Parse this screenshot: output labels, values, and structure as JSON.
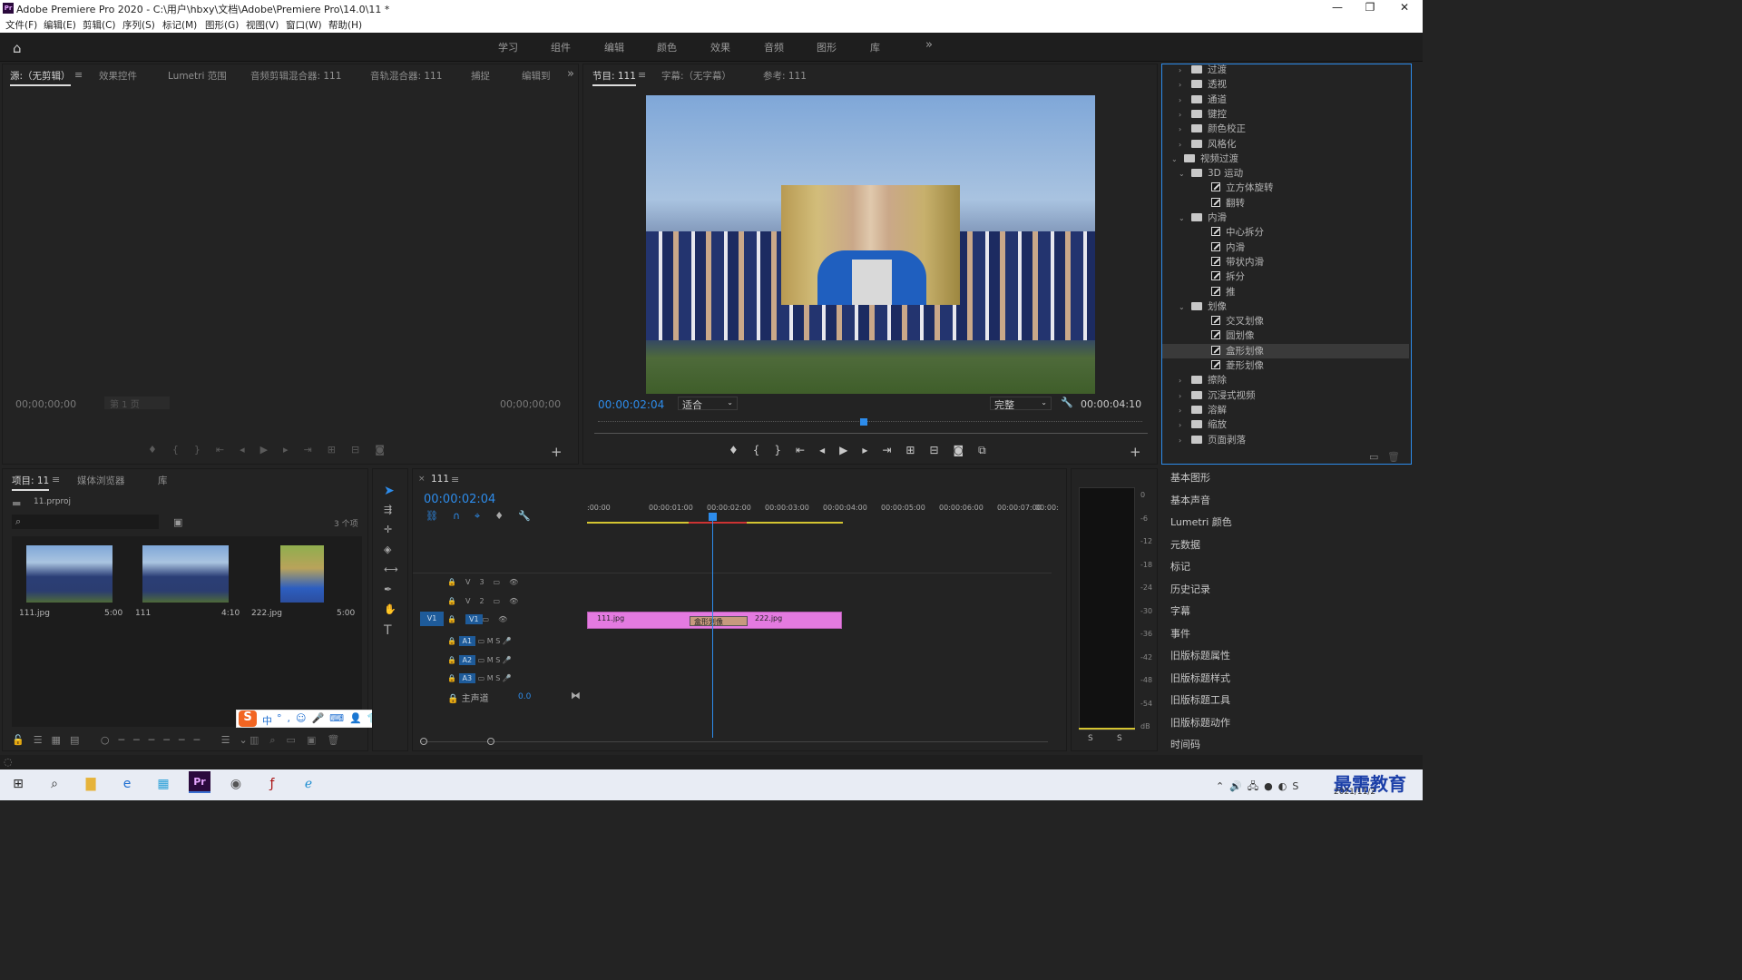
{
  "titlebar": {
    "title": "Adobe Premiere Pro 2020 - C:\\用户\\hbxy\\文档\\Adobe\\Premiere Pro\\14.0\\11 *",
    "minimize": "—",
    "maximize": "❐",
    "close": "✕"
  },
  "menu": [
    "文件(F)",
    "编辑(E)",
    "剪辑(C)",
    "序列(S)",
    "标记(M)",
    "图形(G)",
    "视图(V)",
    "窗口(W)",
    "帮助(H)"
  ],
  "workspaces": [
    "学习",
    "组件",
    "编辑",
    "颜色",
    "效果",
    "音频",
    "图形",
    "库"
  ],
  "source_panel": {
    "tabs": [
      "源:（无剪辑）",
      "效果控件",
      "Lumetri 范围",
      "音频剪辑混合器: 111",
      "音轨混合器: 111",
      "捕捉",
      "编辑到"
    ],
    "tc_left": "00;00;00;00",
    "page": "第 1 页",
    "tc_right": "00;00;00;00"
  },
  "program_panel": {
    "tabs": [
      "节目: 111",
      "字幕:（无字幕）",
      "参考: 111"
    ],
    "timecode": "00:00:02:04",
    "fit": "适合",
    "quality": "完整",
    "duration": "00:00:04:10"
  },
  "effects_tree": [
    {
      "label": "过渡",
      "kind": "folder",
      "indent": 0
    },
    {
      "label": "透视",
      "kind": "folder",
      "indent": 0
    },
    {
      "label": "通道",
      "kind": "folder",
      "indent": 0
    },
    {
      "label": "键控",
      "kind": "folder",
      "indent": 0
    },
    {
      "label": "颜色校正",
      "kind": "folder",
      "indent": 0
    },
    {
      "label": "风格化",
      "kind": "folder",
      "indent": 0
    },
    {
      "label": "视频过渡",
      "kind": "open",
      "indent": -1
    },
    {
      "label": "3D 运动",
      "kind": "open",
      "indent": 1
    },
    {
      "label": "立方体旋转",
      "kind": "fx",
      "indent": 2
    },
    {
      "label": "翻转",
      "kind": "fx",
      "indent": 2
    },
    {
      "label": "内滑",
      "kind": "open",
      "indent": 1
    },
    {
      "label": "中心拆分",
      "kind": "fx",
      "indent": 2
    },
    {
      "label": "内滑",
      "kind": "fx",
      "indent": 2
    },
    {
      "label": "带状内滑",
      "kind": "fx",
      "indent": 2
    },
    {
      "label": "拆分",
      "kind": "fx",
      "indent": 2
    },
    {
      "label": "推",
      "kind": "fx",
      "indent": 2
    },
    {
      "label": "划像",
      "kind": "open",
      "indent": 1
    },
    {
      "label": "交叉划像",
      "kind": "fx",
      "indent": 2
    },
    {
      "label": "圆划像",
      "kind": "fx",
      "indent": 2
    },
    {
      "label": "盒形划像",
      "kind": "fx",
      "indent": 2,
      "selected": true
    },
    {
      "label": "菱形划像",
      "kind": "fx",
      "indent": 2
    },
    {
      "label": "擦除",
      "kind": "folder",
      "indent": 1
    },
    {
      "label": "沉浸式视频",
      "kind": "folder",
      "indent": 1
    },
    {
      "label": "溶解",
      "kind": "folder",
      "indent": 1
    },
    {
      "label": "缩放",
      "kind": "folder",
      "indent": 1
    },
    {
      "label": "页面剥落",
      "kind": "folder",
      "indent": 1
    }
  ],
  "side_panels": [
    "基本图形",
    "基本声音",
    "Lumetri 颜色",
    "元数据",
    "标记",
    "历史记录",
    "字幕",
    "事件",
    "旧版标题属性",
    "旧版标题样式",
    "旧版标题工具",
    "旧版标题动作",
    "时间码"
  ],
  "project_panel": {
    "tabs": [
      "项目: 11",
      "媒体浏览器",
      "库"
    ],
    "file": "11.prproj",
    "count": "3 个项",
    "items": [
      {
        "name": "111.jpg",
        "dur": "5:00"
      },
      {
        "name": "111",
        "dur": "4:10"
      },
      {
        "name": "222.jpg",
        "dur": "5:00"
      }
    ]
  },
  "timeline": {
    "seq": "111",
    "timecode": "00:00:02:04",
    "ruler": [
      ":00:00",
      "00:00:01:00",
      "00:00:02:00",
      "00:00:03:00",
      "00:00:04:00",
      "00:00:05:00",
      "00:00:06:00",
      "00:00:07:00",
      "00:00:"
    ],
    "tracks": [
      "V3",
      "V2",
      "V1",
      "A1",
      "A2",
      "A3"
    ],
    "master": "主声道",
    "master_val": "0.0",
    "clip1": "111.jpg",
    "clip2": "222.jpg",
    "transition": "盒形划像",
    "m": "M",
    "s": "S"
  },
  "meter": {
    "ticks": [
      "0",
      "-6",
      "-12",
      "-18",
      "-24",
      "-30",
      "-36",
      "-42",
      "-48",
      "-54",
      "dB"
    ],
    "s_labels": [
      "S",
      "S"
    ]
  },
  "ime": {
    "zh": "中",
    "label": "S"
  },
  "taskbar": {
    "date": "2021/11/2",
    "watermark": "最需教育"
  },
  "colors": {
    "accent": "#2d8ceb",
    "clip": "#e47ae0",
    "transition": "#c79a7e"
  }
}
